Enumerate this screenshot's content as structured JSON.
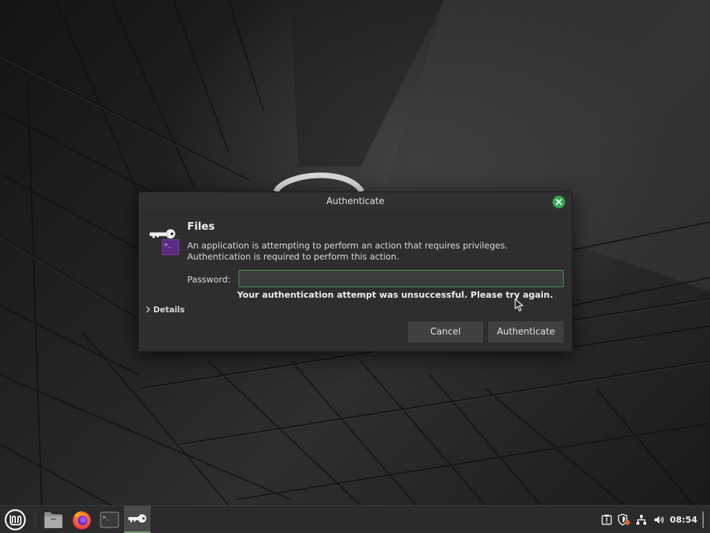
{
  "dialog": {
    "title": "Authenticate",
    "app_name": "Files",
    "message": "An application is attempting to perform an action that requires privileges. Authentication is required to perform this action.",
    "password_label": "Password:",
    "password_value": "",
    "error_message": "Your authentication attempt was unsuccessful. Please try again.",
    "details_label": "Details",
    "cancel_label": "Cancel",
    "authenticate_label": "Authenticate",
    "icons": {
      "close": "close-icon",
      "dialog": "key-lock-icon",
      "details": "chevron-right-icon"
    },
    "colors": {
      "accent": "#35a854",
      "input_focus_border": "#4b9a58"
    }
  },
  "taskbar": {
    "menu_icon": "linux-mint-logo-icon",
    "launchers": [
      {
        "name": "Files",
        "icon": "folder-icon"
      },
      {
        "name": "Firefox",
        "icon": "firefox-icon"
      },
      {
        "name": "Terminal",
        "icon": "terminal-icon"
      }
    ],
    "active_window_icon": "key-icon",
    "tray_icons": [
      "update-manager-icon",
      "shield-icon",
      "network-icon",
      "volume-icon"
    ],
    "clock": "08:54"
  }
}
